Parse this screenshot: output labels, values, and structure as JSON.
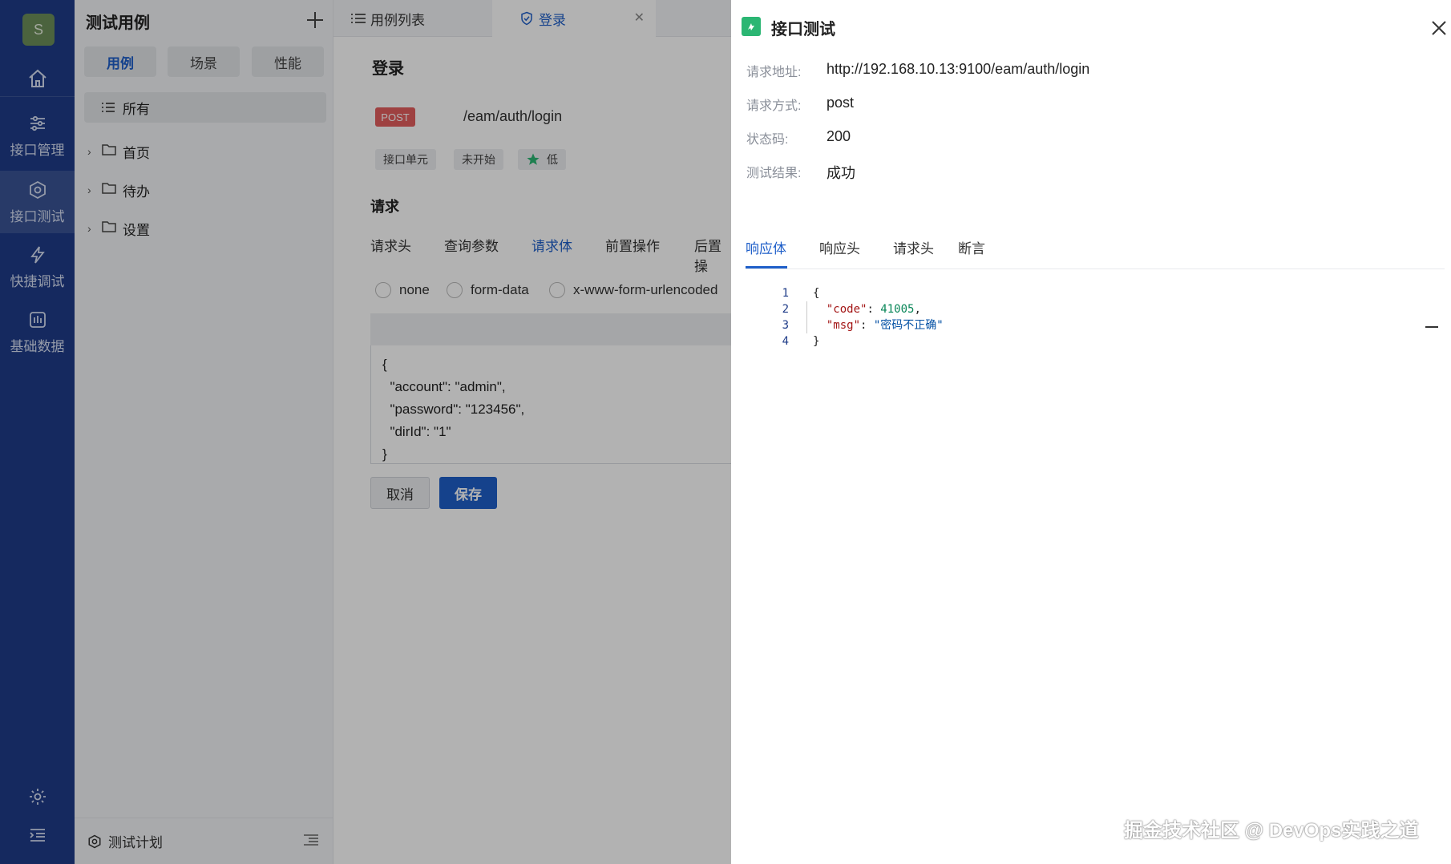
{
  "rail": {
    "avatar": "S",
    "items": [
      {
        "label": "接口管理",
        "icon": "sliders-icon"
      },
      {
        "label": "接口测试",
        "icon": "test-hex-icon"
      },
      {
        "label": "快捷调试",
        "icon": "lightning-icon"
      },
      {
        "label": "基础数据",
        "icon": "data-chart-icon"
      }
    ]
  },
  "sidebar": {
    "title": "测试用例",
    "segments": [
      "用例",
      "场景",
      "性能"
    ],
    "tree": {
      "all": "所有",
      "nodes": [
        "首页",
        "待办",
        "设置"
      ]
    },
    "footer": "测试计划"
  },
  "tabs": {
    "list": "用例列表",
    "current": "登录"
  },
  "case": {
    "title": "登录",
    "method": "POST",
    "path": "/eam/auth/login",
    "tags": {
      "type": "接口单元",
      "status": "未开始",
      "priority": "低"
    },
    "request_section": "请求",
    "request_tabs": [
      "请求头",
      "查询参数",
      "请求体",
      "前置操作",
      "后置操"
    ],
    "body_types": [
      "none",
      "form-data",
      "x-www-form-urlencoded"
    ],
    "body_lines": [
      "{",
      "  \"account\": \"admin\",",
      "  \"password\": \"123456\",",
      "  \"dirId\": \"1\"",
      "}"
    ],
    "cancel": "取消",
    "save": "保存"
  },
  "drawer": {
    "title": "接口测试",
    "info": [
      {
        "label": "请求地址:",
        "value": "http://192.168.10.13:9100/eam/auth/login"
      },
      {
        "label": "请求方式:",
        "value": "post"
      },
      {
        "label": "状态码:",
        "value": "200"
      },
      {
        "label": "测试结果:",
        "value": "成功"
      }
    ],
    "tabs": [
      "响应体",
      "响应头",
      "请求头",
      "断言"
    ],
    "code": {
      "line_numbers": [
        "1",
        "2",
        "3",
        "4"
      ],
      "open": "{",
      "key1": "\"code\"",
      "val1": "41005",
      "key2": "\"msg\"",
      "val2": "\"密码不正确\"",
      "close": "}"
    }
  },
  "watermark": "掘金技术社区 @ DevOps实践之道",
  "colors": {
    "rail": "#1f3c88",
    "accent": "#1f5fc9",
    "post": "#e35e5e",
    "success_icon": "#2bb673"
  }
}
